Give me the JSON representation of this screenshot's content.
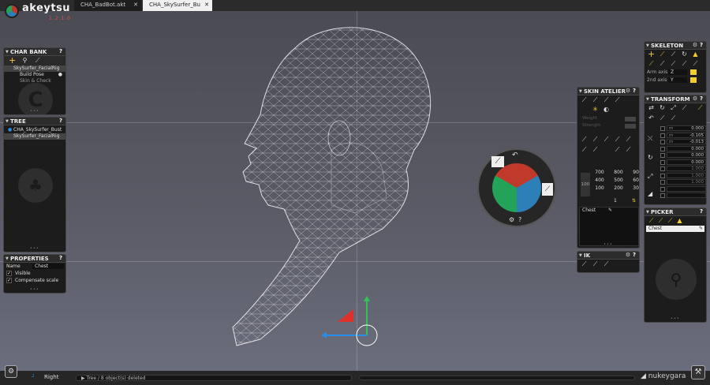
{
  "app": {
    "name": "akeytsu",
    "version": "1.2.1.0"
  },
  "tabs": [
    {
      "label": "CHA_BadBot.akt",
      "active": false
    },
    {
      "label": "CHA_SkySurfer_Bu",
      "active": true
    }
  ],
  "colors": {
    "accent_yellow": "#f3cc2e",
    "wheel_red": "#c0392b",
    "wheel_green": "#23a35a",
    "wheel_blue": "#2d7fb8",
    "gizmo_red": "#e0302a",
    "gizmo_green": "#2fc35a",
    "gizmo_blue": "#2a8ee6"
  },
  "char_bank": {
    "title": "CHAR BANK",
    "help": "?",
    "items": [
      "SkySurfer_FacialRig",
      "Build Pose",
      "Skin & Check"
    ]
  },
  "tree": {
    "title": "TREE",
    "help": "?",
    "items": [
      "CHA_SkySurfer_Bust",
      "SkySurfer_FacialRig"
    ]
  },
  "properties": {
    "title": "PROPERTIES",
    "help": "?",
    "name_label": "Name",
    "name_value": "Chest",
    "visible_label": "Visible",
    "compensate_label": "Compensate scale"
  },
  "skeleton": {
    "title": "SKELETON",
    "help": "?",
    "arm_axis_label": "Arm axis",
    "arm_axis_value": "Z",
    "second_axis_label": "2nd axis",
    "second_axis_value": "Y"
  },
  "skin_atelier": {
    "title": "SKIN ATELIER",
    "help": "?",
    "weight_label": "Weight",
    "strength_label": "Strength",
    "brush_label": "100",
    "grid_values": [
      "700",
      "800",
      "900",
      "400",
      "500",
      "600",
      "100",
      "200",
      "300"
    ],
    "bottom_value": "1"
  },
  "bone_list": {
    "selected": "Chest"
  },
  "ik": {
    "title": "IK",
    "help": "?"
  },
  "transform": {
    "title": "TRANSFORM",
    "help": "?",
    "rows": [
      {
        "label": "m",
        "value": "0.000"
      },
      {
        "label": "m",
        "value": "-0.105"
      },
      {
        "label": "m",
        "value": "-0.013"
      },
      {
        "label": "",
        "value": "0.000"
      },
      {
        "label": "",
        "value": "0.000"
      },
      {
        "label": "",
        "value": "0.000"
      },
      {
        "label": "",
        "value": "1.000"
      },
      {
        "label": "",
        "value": "1.000"
      },
      {
        "label": "",
        "value": "1.000"
      }
    ]
  },
  "picker": {
    "title": "PICKER",
    "help": "?",
    "selected": "Chest"
  },
  "viewport": {
    "camera_label": "Right"
  },
  "status": {
    "message": "Tree / 8 object(s) deleted"
  },
  "brand": {
    "name": "nukeygara"
  }
}
